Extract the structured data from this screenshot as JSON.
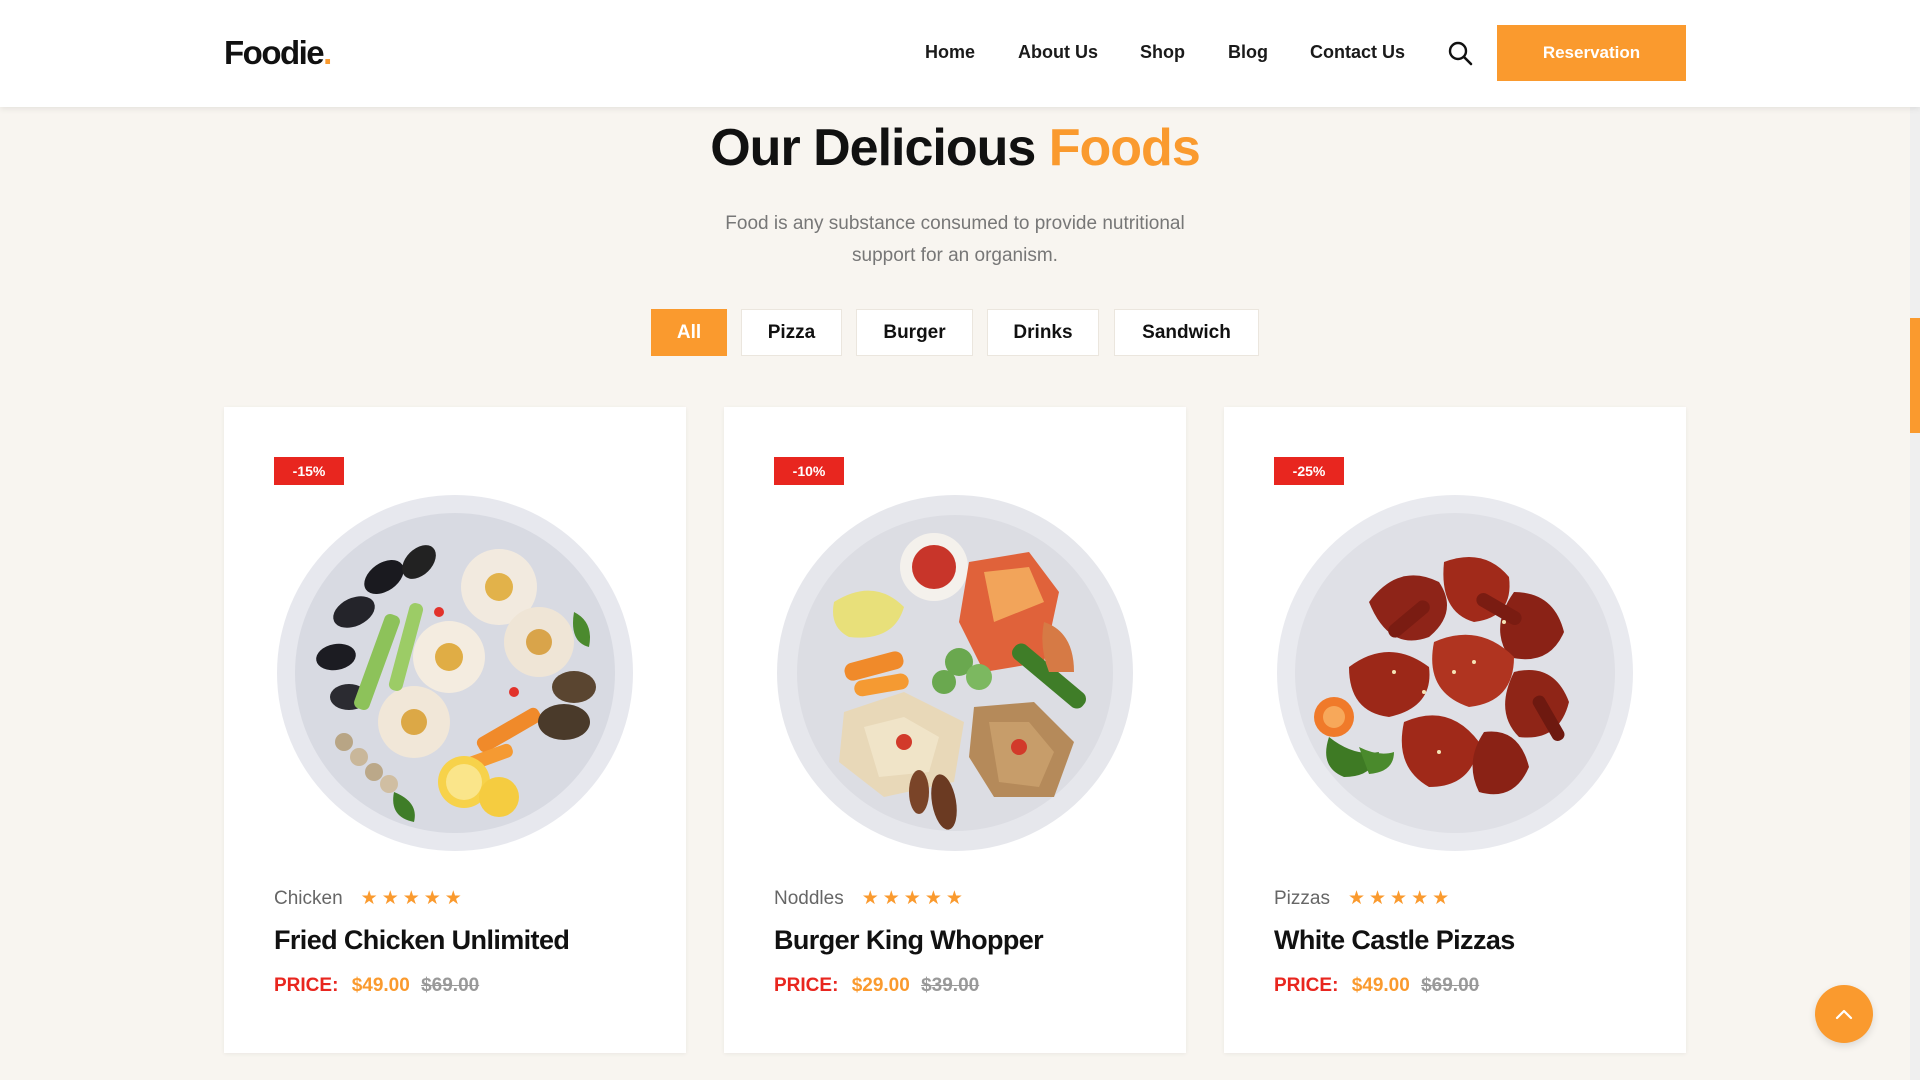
{
  "brand": {
    "name": "Foodie",
    "dot": "."
  },
  "nav": [
    "Home",
    "About Us",
    "Shop",
    "Blog",
    "Contact Us"
  ],
  "search": {
    "icon": "search-icon"
  },
  "reservation_label": "Reservation",
  "section": {
    "title_main": "Our Delicious ",
    "title_accent": "Foods",
    "subtitle": "Food is any substance consumed to provide nutritional support for an organism."
  },
  "filters": [
    "All",
    "Pizza",
    "Burger",
    "Drinks",
    "Sandwich"
  ],
  "active_filter": "All",
  "products": [
    {
      "badge": "-15%",
      "category": "Chicken",
      "rating": 5,
      "stars": "★★★★★",
      "name": "Fried Chicken Unlimited",
      "price_label": "PRICE:",
      "price": "$49.00",
      "old_price": "$69.00"
    },
    {
      "badge": "-10%",
      "category": "Noddles",
      "rating": 5,
      "stars": "★★★★★",
      "name": "Burger King Whopper",
      "price_label": "PRICE:",
      "price": "$29.00",
      "old_price": "$39.00"
    },
    {
      "badge": "-25%",
      "category": "Pizzas",
      "rating": 5,
      "stars": "★★★★★",
      "name": "White Castle Pizzas",
      "price_label": "PRICE:",
      "price": "$49.00",
      "old_price": "$69.00"
    }
  ],
  "colors": {
    "accent": "#fa9a2e",
    "sale": "#e8261f",
    "background": "#f8f5f0"
  },
  "back_to_top": {
    "icon": "chevron-up-icon"
  }
}
